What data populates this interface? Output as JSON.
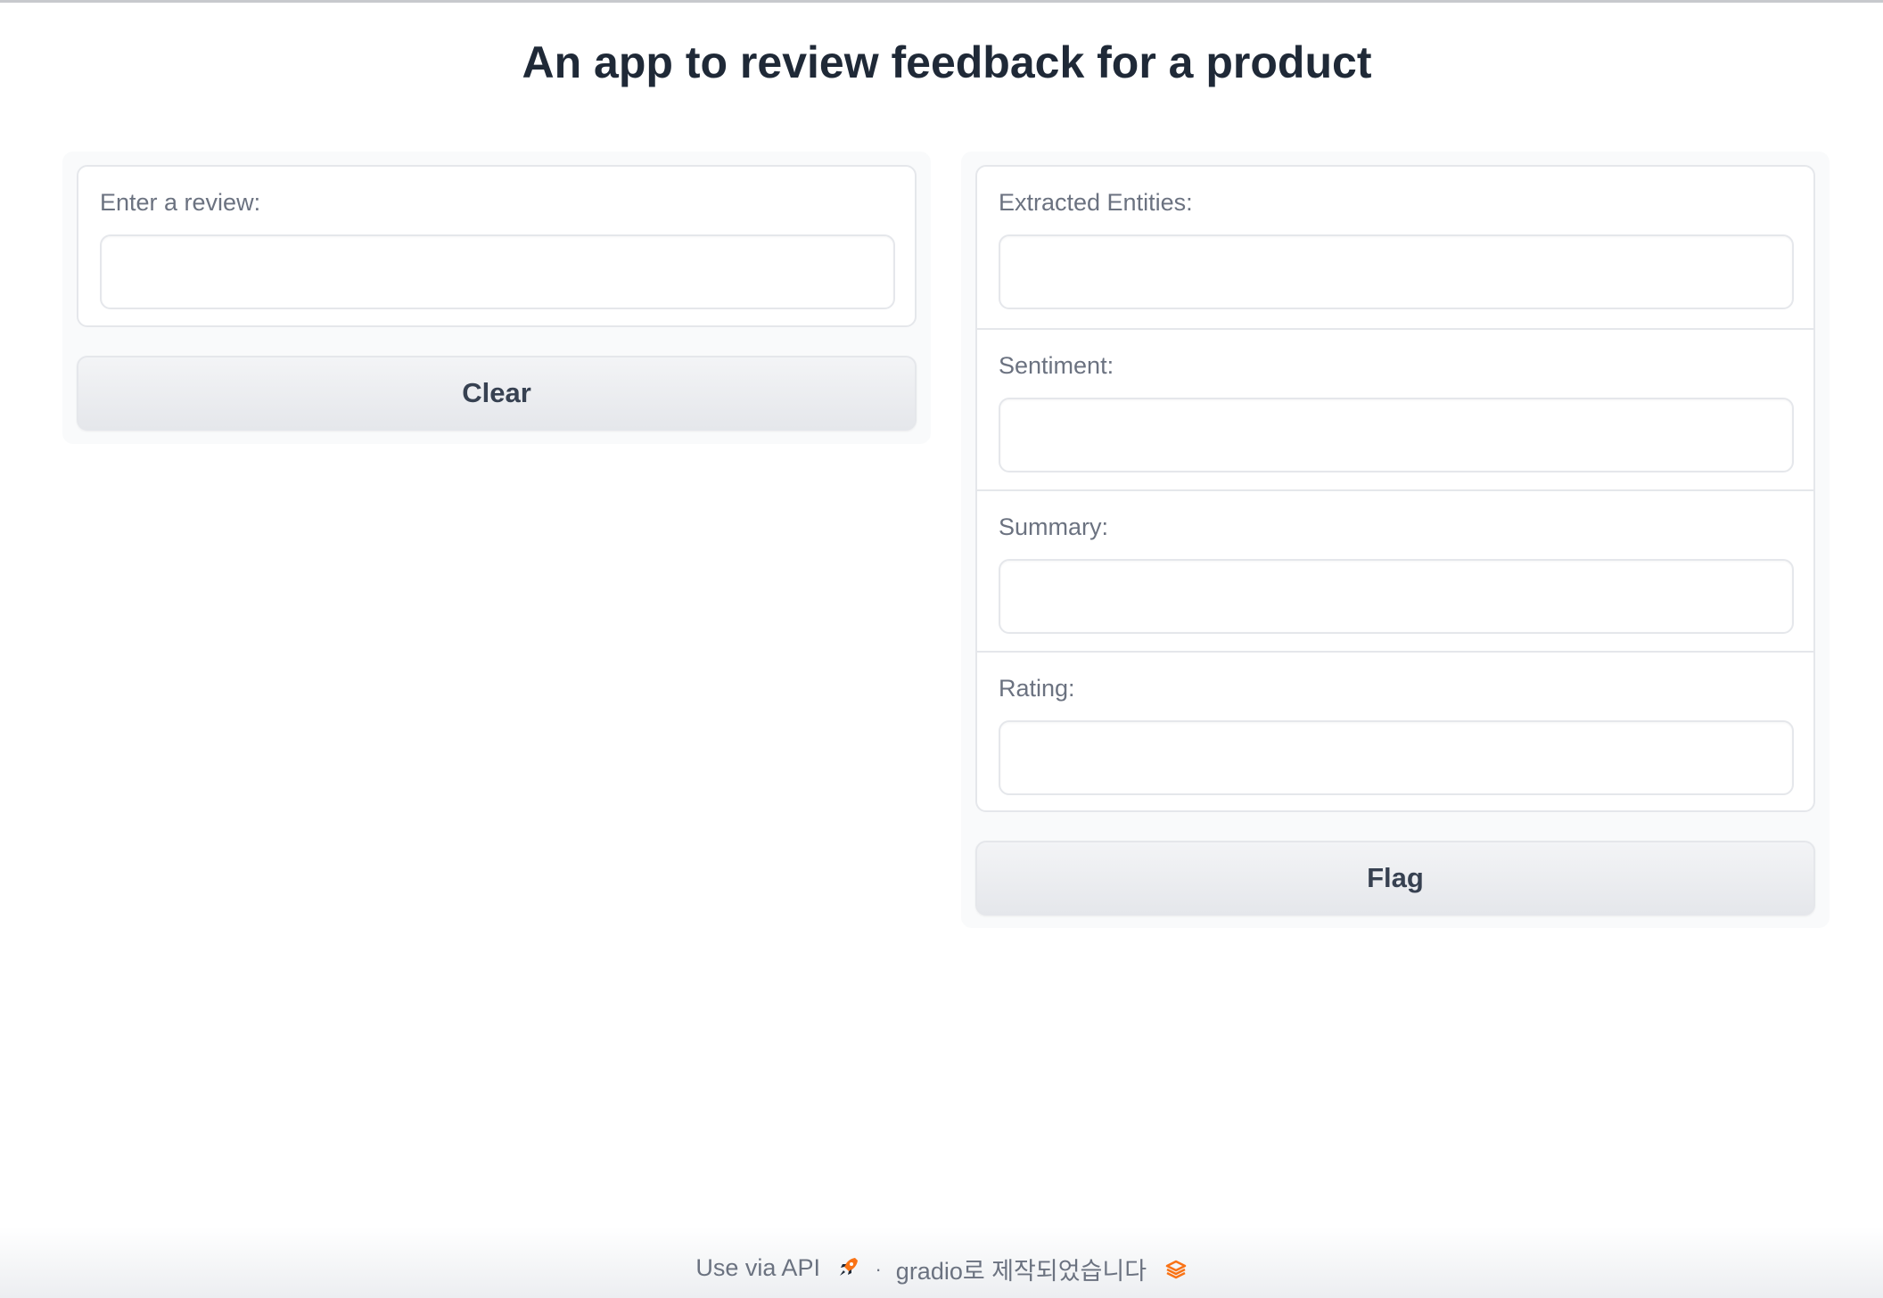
{
  "app": {
    "title": "An app to review feedback for a product"
  },
  "input_panel": {
    "review_label": "Enter a review:",
    "review_value": "",
    "clear_label": "Clear"
  },
  "output_panel": {
    "fields": [
      {
        "label": "Extracted Entities:",
        "value": ""
      },
      {
        "label": "Sentiment:",
        "value": ""
      },
      {
        "label": "Summary:",
        "value": ""
      },
      {
        "label": "Rating:",
        "value": ""
      }
    ],
    "flag_label": "Flag"
  },
  "footer": {
    "api_label": "Use via API",
    "api_icon": "rocket-icon",
    "separator": "·",
    "built_with_label": "gradio로 제작되었습니다",
    "brand_icon": "gradio-logo-icon"
  },
  "colors": {
    "accent": "#f97316",
    "text": "#1f2937",
    "muted": "#6b7280",
    "border": "#e5e7eb"
  }
}
